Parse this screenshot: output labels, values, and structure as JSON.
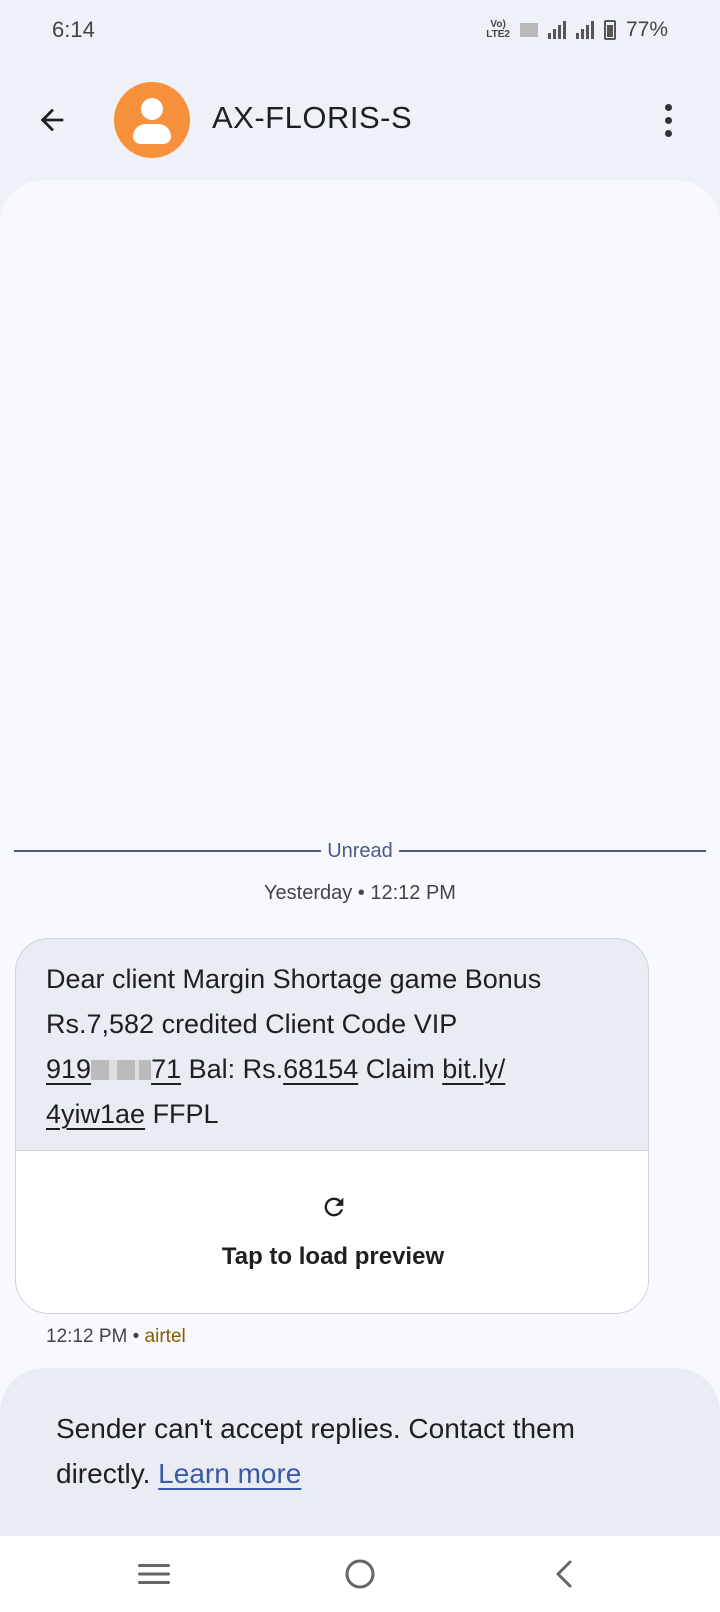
{
  "status_bar": {
    "time": "6:14",
    "network_label": "Vo LTE2",
    "battery": "77%"
  },
  "app_bar": {
    "back_icon": "arrow-left-icon",
    "avatar_icon": "person-icon",
    "avatar_color": "#f7903a",
    "title": "AX-FLORIS-S",
    "more_icon": "more-vert-icon"
  },
  "conversation": {
    "unread_label": "Unread",
    "timestamp": "Yesterday • 12:12 PM",
    "message": {
      "line1": "Dear client Margin Shortage game Bonus",
      "line2": "Rs.7,582 credited Client Code VIP",
      "code_prefix": "919",
      "code_suffix": "71",
      "bal_prefix": " Bal: Rs.",
      "bal_value": "68154",
      "claim_text": " Claim ",
      "link_part1": "bit.ly/",
      "link_part2": "4yiw1ae",
      "tail": " FFPL"
    },
    "preview": {
      "icon": "refresh-icon",
      "label": "Tap to load preview"
    },
    "meta": {
      "time": "12:12 PM",
      "separator": " • ",
      "carrier": "airtel"
    }
  },
  "info_card": {
    "text": "Sender can't accept replies. Contact them directly. ",
    "link": "Learn more"
  },
  "nav_bar": {
    "recents_icon": "menu-lines-icon",
    "home_icon": "home-circle-icon",
    "back_icon": "chevron-left-icon"
  }
}
